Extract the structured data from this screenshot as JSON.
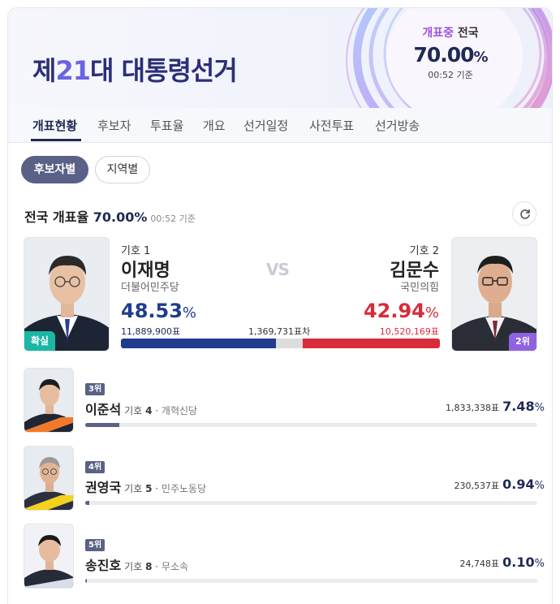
{
  "header": {
    "title_prefix": "제",
    "title_num": "21",
    "title_suffix": "대 대통령선거",
    "status_highlight": "개표중",
    "status_region": " 전국",
    "status_pct_value": "70.00",
    "status_pct_unit": "%",
    "status_time": "00:52 기준"
  },
  "tabs": [
    "개표현황",
    "후보자",
    "투표율",
    "개요",
    "선거일정",
    "사전투표",
    "선거방송"
  ],
  "toggle": {
    "on_label": "후보자별",
    "off_label": "지역별"
  },
  "section": {
    "title": "전국 개표율",
    "pct_value": "70.00",
    "pct_unit": "%",
    "time": "00:52 기준"
  },
  "main_match": {
    "vs": "VS",
    "gap": "1,369,731표차",
    "leader": {
      "number_label": "기호 1",
      "name": "이재명",
      "party": "더불어민주당",
      "pct": "48.53",
      "pct_unit": "%",
      "votes": "11,889,900표",
      "badge": "확실",
      "color": "#1f3c8f"
    },
    "runner_up": {
      "number_label": "기호 2",
      "name": "김문수",
      "party": "국민의힘",
      "pct": "42.94",
      "pct_unit": "%",
      "votes": "10,520,169표",
      "badge": "2위",
      "color": "#d92b3a"
    },
    "bar": {
      "leader_share": 48.53,
      "runner_share": 42.94
    }
  },
  "others": [
    {
      "rank": "3위",
      "name": "이준석",
      "number_label": "기호",
      "number": "4",
      "party": "개혁신당",
      "votes": "1,833,338표",
      "pct": "7.48",
      "pct_unit": "%",
      "share": 7.48
    },
    {
      "rank": "4위",
      "name": "권영국",
      "number_label": "기호",
      "number": "5",
      "party": "민주노동당",
      "votes": "230,537표",
      "pct": "0.94",
      "pct_unit": "%",
      "share": 0.94
    },
    {
      "rank": "5위",
      "name": "송진호",
      "number_label": "기호",
      "number": "8",
      "party": "무소속",
      "votes": "24,748표",
      "pct": "0.10",
      "pct_unit": "%",
      "share": 0.1
    }
  ],
  "colors": {
    "accent": "#1f2a55",
    "leader": "#1f3c8f",
    "runner": "#d92b3a",
    "win_badge": "#1bb7a4",
    "rank_badge": "#8f63e0"
  }
}
